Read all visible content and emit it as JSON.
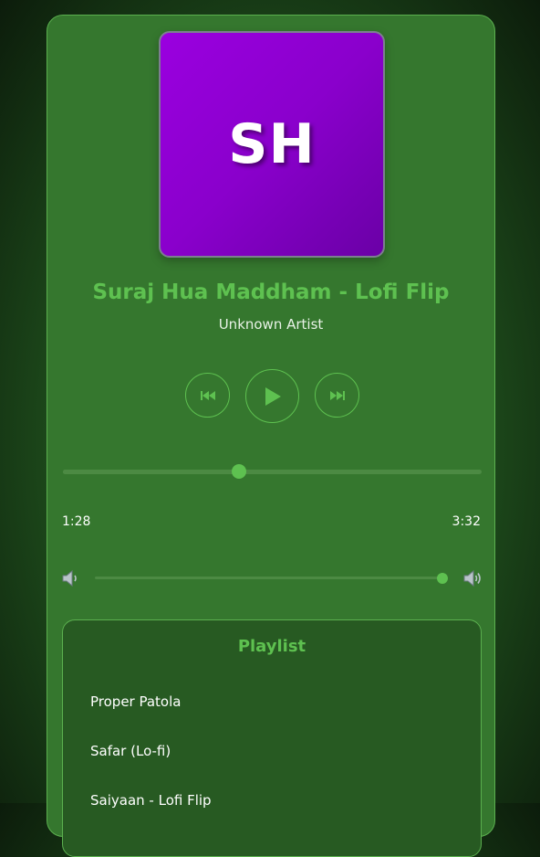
{
  "cover": {
    "initials": "SH",
    "color_top": "#9a00df",
    "color_bottom": "#6a00a6"
  },
  "song": {
    "title": "Suraj Hua Maddham - Lofi Flip",
    "artist": "Unknown Artist"
  },
  "controls": {
    "prev_icon": "skip-previous-icon",
    "play_icon": "play-icon",
    "next_icon": "skip-next-icon"
  },
  "progress": {
    "current": "1:28",
    "duration": "3:32",
    "fraction": 0.42
  },
  "volume": {
    "low_icon": "speaker-low-icon",
    "high_icon": "speaker-high-icon",
    "fraction": 0.995
  },
  "playlist": {
    "title": "Playlist",
    "tracks": [
      "Proper Patola",
      "Safar (Lo-fi)",
      "Saiyaan - Lofi Flip"
    ]
  },
  "colors": {
    "accent": "#5ec150",
    "panel": "#35772e",
    "playlist_bg": "#275a22"
  }
}
